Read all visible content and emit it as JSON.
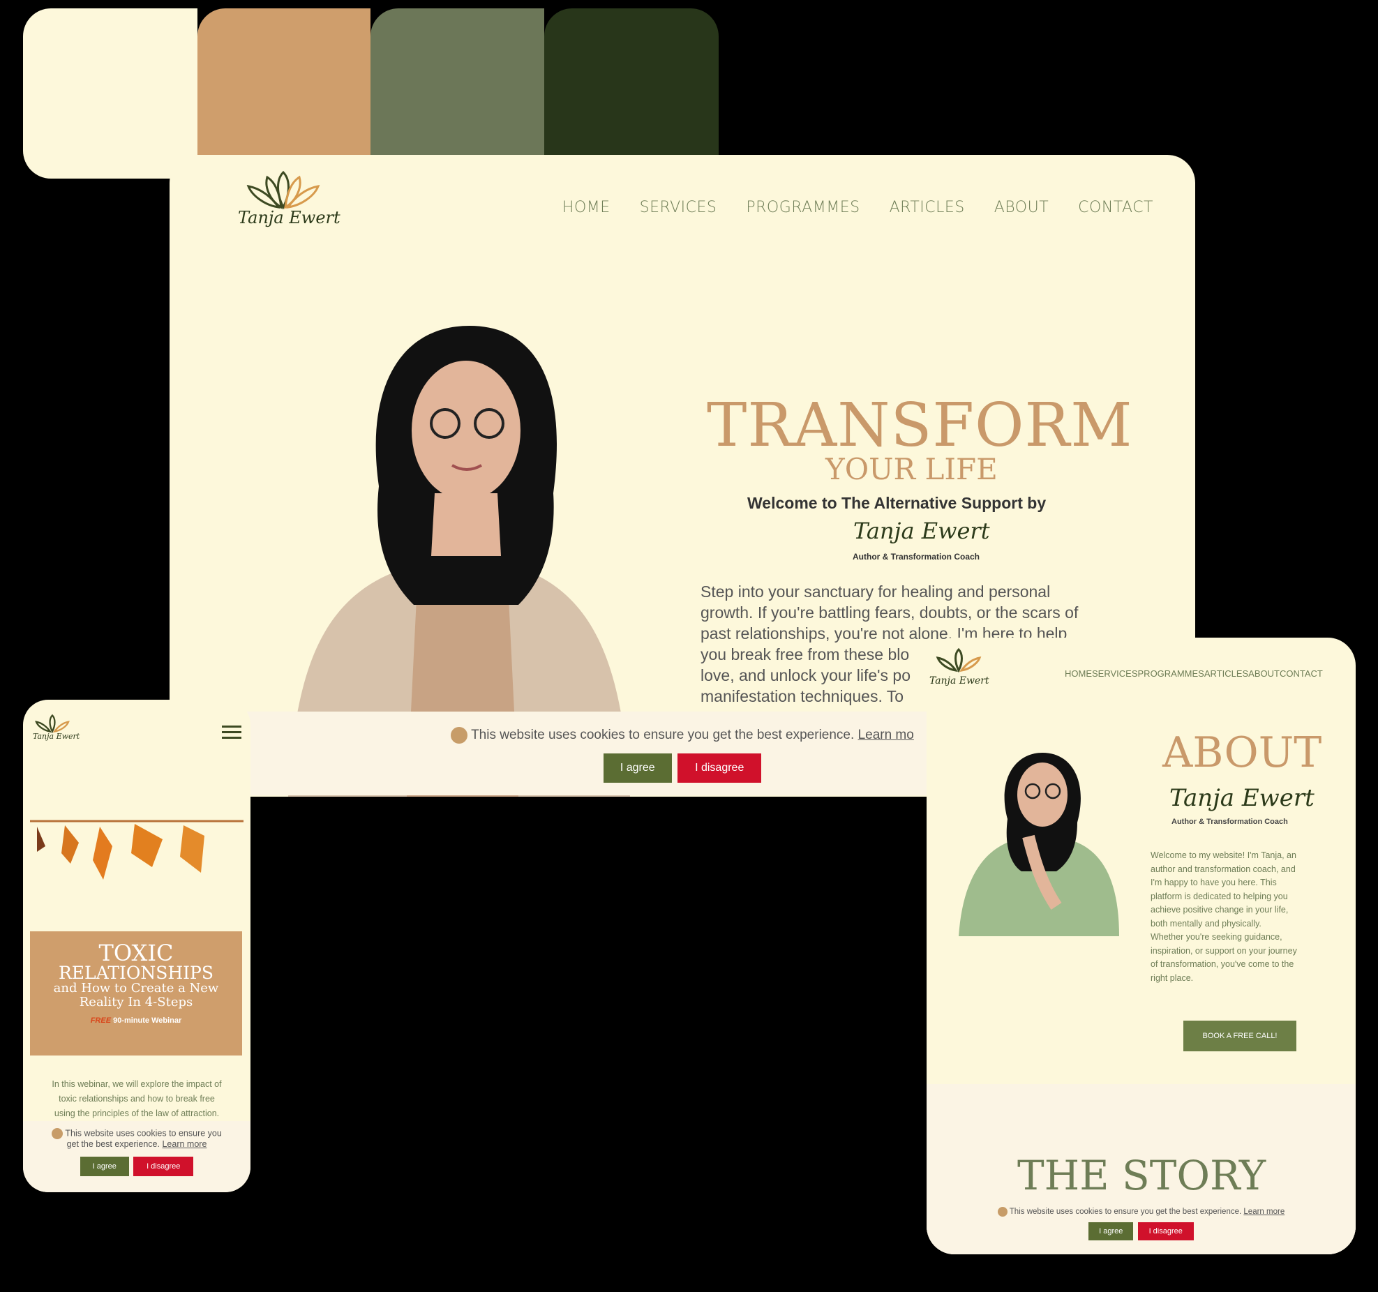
{
  "palette": {
    "colors": [
      "#fdf8db",
      "#cf9e6c",
      "#6c7758",
      "#28361a"
    ]
  },
  "brand": {
    "logo_text": "Tanja Ewert",
    "logo_icon": "lotus-icon",
    "tagline": "Author & Transformation Coach"
  },
  "desktop": {
    "nav": [
      "HOME",
      "SERVICES",
      "PROGRAMMES",
      "ARTICLES",
      "ABOUT",
      "CONTACT"
    ],
    "hero_title": "TRANSFORM",
    "hero_subtitle": "YOUR LIFE",
    "welcome": "Welcome to The Alternative Support by",
    "signature": "Tanja Ewert",
    "tagline": "Author & Transformation Coach",
    "intro_lines": [
      "Step into your sanctuary for healing and personal",
      "growth. If you're battling fears, doubts, or the scars of",
      "past relationships, you're not alone. I'm here to help",
      "you break free from these blo",
      "love, and unlock your life's po",
      "manifestation techniques. To"
    ],
    "cookie_text": "This website uses cookies to ensure you get the best experience.",
    "cookie_link": "Learn mo",
    "agree": "I agree",
    "disagree": "I disagree"
  },
  "mobile": {
    "webinar_title_1": "TOXIC",
    "webinar_title_2": "RELATIONSHIPS",
    "webinar_sub_1": "and How to Create a New",
    "webinar_sub_2": "Reality In 4-Steps",
    "webinar_free": "FREE",
    "webinar_length": "90-minute Webinar",
    "body_lines": [
      "In this webinar, we will explore the impact of",
      "toxic relationships and how to break free",
      "using the principles of the law of attraction."
    ],
    "cookie_line_1": "This website uses cookies to ensure you",
    "cookie_line_2": "get the best experience.",
    "cookie_link": "Learn more",
    "agree": "I agree",
    "disagree": "I disagree"
  },
  "tablet": {
    "nav": "HOMESERVICESPROGRAMMESARTICLESABOUTCONTACT",
    "about_title": "ABOUT",
    "signature": "Tanja Ewert",
    "tagline": "Author & Transformation Coach",
    "about_lines": [
      "Welcome to my website! I'm Tanja, an",
      "author and transformation coach, and",
      "I'm happy to have you here. This",
      "platform is dedicated to helping you",
      "achieve positive change in your life,",
      "both mentally and physically.",
      "Whether you're seeking guidance,",
      "inspiration, or support on your journey",
      "of transformation, you've come to the",
      "right place."
    ],
    "cta": "BOOK A FREE CALL!",
    "story_title": "THE STORY",
    "cookie_text": "This website uses cookies to ensure you get the best experience.",
    "cookie_link": "Learn more",
    "agree": "I agree",
    "disagree": "I disagree"
  }
}
